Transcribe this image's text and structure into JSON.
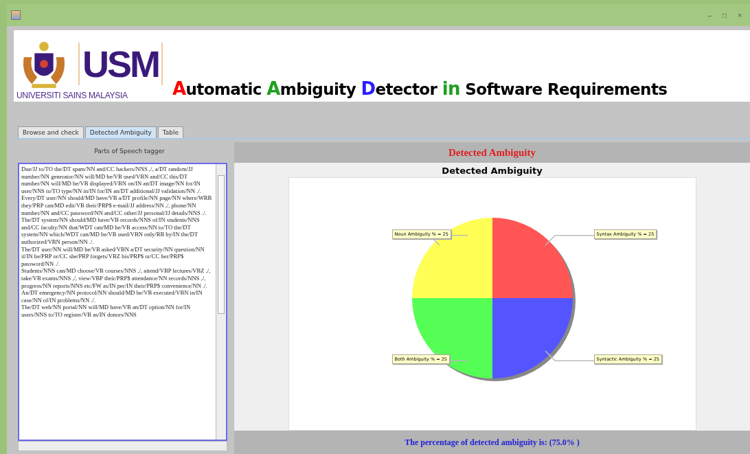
{
  "window": {
    "controls": [
      "–",
      "□",
      "×"
    ]
  },
  "banner": {
    "logo_letters": "USM",
    "logo_caption": "UNIVERSITI SAINS MALAYSIA",
    "title_parts": [
      {
        "text": "A",
        "color": "#ff0000"
      },
      {
        "text": "utomatic ",
        "color": "#000000"
      },
      {
        "text": "A",
        "color": "#1fa01f"
      },
      {
        "text": "mbiguity ",
        "color": "#000000"
      },
      {
        "text": "D",
        "color": "#2a1cff"
      },
      {
        "text": "etector ",
        "color": "#000000"
      },
      {
        "text": "in",
        "color": "#1fa01f"
      },
      {
        "text": " Software Requirements",
        "color": "#000000"
      }
    ]
  },
  "tabs": [
    {
      "label": "Browse and check",
      "selected": false
    },
    {
      "label": "Detected Ambiguity",
      "selected": true
    },
    {
      "label": "Table",
      "selected": false
    }
  ],
  "tagger": {
    "title": "Parts of Speech tagger",
    "sentences": [
      "Due/JJ to/TO the/DT spam/NN and/CC hackers/NNS ,/, a/DT random/JJ number/NN generator/NN will/MD be/VB used/VBN and/CC this/DT number/NN will/MD be/VB displayed/VBN on/IN an/DT image/NN for/IN user/NNS to/TO type/NN in/IN for/IN an/DT additional/JJ validation/NN ./.",
      "Every/DT user/NN should/MD have/VB a/DT profile/NN page/NN where/WRB they/PRP can/MD edit/VB their/PRP$ e-mail/JJ address/NN ,/, phone/NN number/NN and/CC password/NN and/CC other/JJ personal/JJ details/NNS ./.",
      "The/DT system/NN should/MD have/VB records/NNS of/IN students/NNS and/CC faculty/NN that/WDT can/MD be/VB access/NN to/TO the/DT system/NN which/WDT can/MD be/VB used/VBN only/RB by/IN the/DT authorized/VBN person/NN ./.",
      "The/DT user/NN will/MD be/VB asked/VBN a/DT security/NN question/NN if/IN he/PRP or/CC she/PRP forgets/VBZ his/PRP$ or/CC her/PRP$ password/NN ./.",
      "Students/NNS can/MD choose/VB courses/NNS ,/, attend/VBP lectures/VBZ ,/, take/VB exams/NNS ,/, view/VBP their/PRP$ attendance/NN records/NNS ,/, progress/NN reports/NNS etc/FW as/IN per/IN their/PRP$ convenience/NN ./.",
      "An/DT emergency/NN protocol/NN should/MD be/VB executed/VBN in/IN case/NN of/IN problems/NN ./.",
      "The/DT web/NN portal/NN will/MD have/VB an/DT option/NN for/IN users/NNS to/TO register/VB as/IN donors/NNS"
    ]
  },
  "result": {
    "title": "Detected Ambiguity",
    "chart_data": {
      "type": "pie",
      "title": "Detected Ambiguity",
      "values": [
        25,
        25,
        25,
        25
      ],
      "value_labels": [
        "Syntax Ambiguity % = 25",
        "Syntactic Ambiguity % = 25",
        "Both Ambiguity % = 25",
        "Noun Ambiguity % = 25"
      ]
    },
    "percentage": "The percentage of detected ambiguity is: (75.0% )"
  }
}
